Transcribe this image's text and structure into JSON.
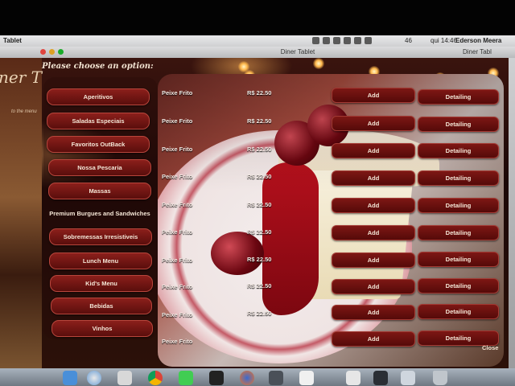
{
  "menubar": {
    "app_title": "Tablet",
    "battery": "46",
    "clock": "qui 14:46",
    "user": "Ederson Meera"
  },
  "window": {
    "title": "Diner Tablet",
    "title_partial": "Diner Tabl"
  },
  "app": {
    "brand": "ner T",
    "brand_sub": "to the menu",
    "prompt": "Please choose an option:",
    "categories": [
      {
        "label": "Aperitivos"
      },
      {
        "label": "Saladas Especiais"
      },
      {
        "label": "Favoritos OutBack"
      },
      {
        "label": "Nossa Pescaria"
      },
      {
        "label": "Massas"
      },
      {
        "label": "Premium Burgues and Sandwiches"
      },
      {
        "label": "Sobremessas Irresistiveis"
      },
      {
        "label": "Lunch Menu"
      },
      {
        "label": "Kid's Menu"
      },
      {
        "label": "Bebidas"
      },
      {
        "label": "Vinhos"
      }
    ],
    "items": [
      {
        "name": "Peixe Frito",
        "price": "R$ 22.50",
        "add": "Add",
        "detail": "Detailing"
      },
      {
        "name": "Peixe Frito",
        "price": "R$ 22.50",
        "add": "Add",
        "detail": "Detailing"
      },
      {
        "name": "Peixe Frito",
        "price": "R$ 22.50",
        "add": "Add",
        "detail": "Detailing"
      },
      {
        "name": "Peixe Frito",
        "price": "R$ 22.50",
        "add": "Add",
        "detail": "Detailing"
      },
      {
        "name": "Peixe Frito",
        "price": "R$ 22.50",
        "add": "Add",
        "detail": "Detailing"
      },
      {
        "name": "Peixe Frito",
        "price": "R$ 22.50",
        "add": "Add",
        "detail": "Detailing"
      },
      {
        "name": "Peixe Frito",
        "price": "R$ 22.50",
        "add": "Add",
        "detail": "Detailing"
      },
      {
        "name": "Peixe Frito",
        "price": "R$ 22.50",
        "add": "Add",
        "detail": "Detailing"
      },
      {
        "name": "Peixe Frito",
        "price": "R$ 22.50",
        "add": "Add",
        "detail": "Detailing"
      },
      {
        "name": "Peixe Frito",
        "price": "",
        "add": "Add",
        "detail": "Detailing"
      }
    ],
    "close_label": "Close"
  },
  "colors": {
    "button_red": "#6b1210",
    "button_border": "#a43a33",
    "text_light": "#f4e6d6"
  },
  "dock": {
    "icons": [
      "finder-icon",
      "safari-icon",
      "app-icon",
      "chrome-icon",
      "qt-icon",
      "terminal-icon",
      "firefox-icon",
      "window-icon",
      "preview-icon",
      "app-icon",
      "screen-icon",
      "folder-icon",
      "trash-icon"
    ]
  }
}
